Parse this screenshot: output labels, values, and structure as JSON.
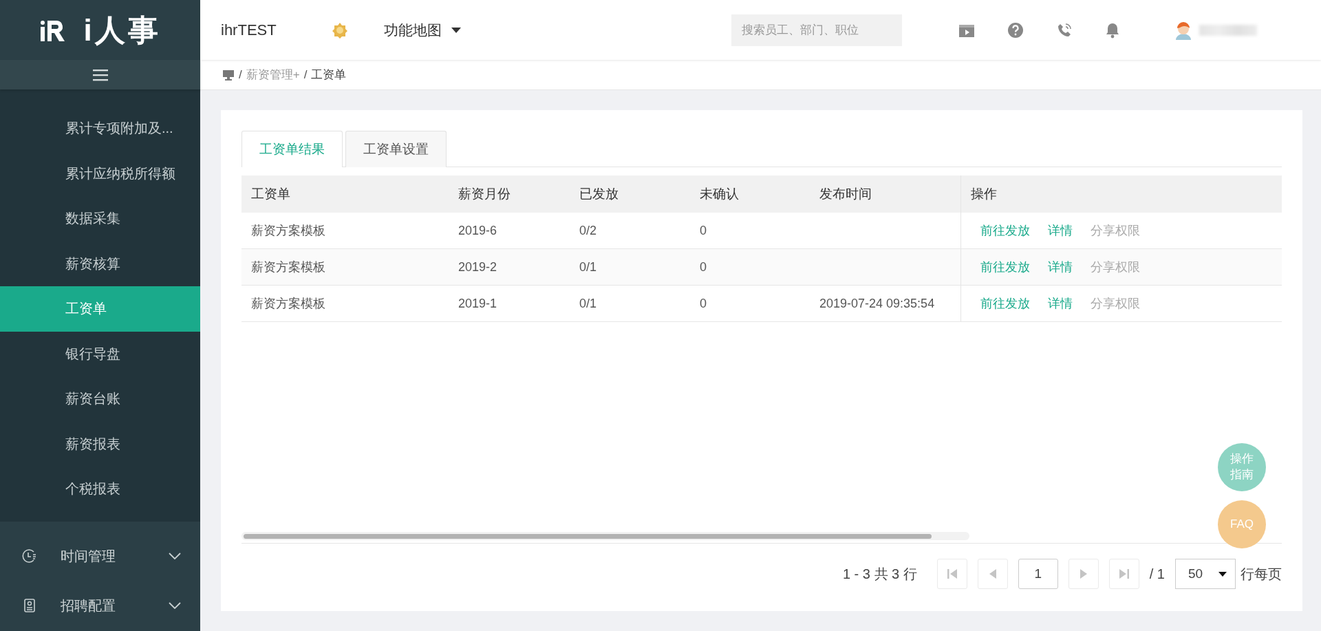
{
  "logo": {
    "text": "i人事"
  },
  "sidebar": {
    "items": [
      {
        "label": "累计专项附加及...",
        "selected": false
      },
      {
        "label": "累计应纳税所得额",
        "selected": false
      },
      {
        "label": "数据采集",
        "selected": false
      },
      {
        "label": "薪资核算",
        "selected": false
      },
      {
        "label": "工资单",
        "selected": true
      },
      {
        "label": "银行导盘",
        "selected": false
      },
      {
        "label": "薪资台账",
        "selected": false
      },
      {
        "label": "薪资报表",
        "selected": false
      },
      {
        "label": "个税报表",
        "selected": false
      }
    ],
    "sections": [
      {
        "label": "时间管理",
        "kind": "clock",
        "expanded": false
      },
      {
        "label": "招聘配置",
        "kind": "badge",
        "expanded": false
      }
    ]
  },
  "header": {
    "company": "ihrTEST",
    "menu": "功能地图",
    "search": {
      "placeholder": "搜索员工、部门、职位"
    }
  },
  "breadcrumb": {
    "separator": "/",
    "items": [
      {
        "label": "薪资管理+",
        "kind": "link"
      },
      {
        "label": "工资单",
        "kind": "current"
      }
    ]
  },
  "tabs": [
    {
      "label": "工资单结果",
      "selected": true
    },
    {
      "label": "工资单设置",
      "selected": false
    }
  ],
  "table": {
    "columns": [
      "工资单",
      "薪资月份",
      "已发放",
      "未确认",
      "发布时间",
      "操作"
    ],
    "rows": [
      {
        "cells": [
          "薪资方案模板",
          "2019-6",
          "0/2",
          "0",
          ""
        ],
        "actions": [
          {
            "label": "前往发放",
            "disabled": false
          },
          {
            "label": "详情",
            "disabled": false
          },
          {
            "label": "分享权限",
            "disabled": true
          }
        ]
      },
      {
        "cells": [
          "薪资方案模板",
          "2019-2",
          "0/1",
          "0",
          ""
        ],
        "actions": [
          {
            "label": "前往发放",
            "disabled": false
          },
          {
            "label": "详情",
            "disabled": false
          },
          {
            "label": "分享权限",
            "disabled": true
          }
        ]
      },
      {
        "cells": [
          "薪资方案模板",
          "2019-1",
          "0/1",
          "0",
          "2019-07-24 09:35:54"
        ],
        "actions": [
          {
            "label": "前往发放",
            "disabled": false
          },
          {
            "label": "详情",
            "disabled": false
          },
          {
            "label": "分享权限",
            "disabled": true
          }
        ]
      }
    ]
  },
  "pagination": {
    "summary": "1 - 3 共 3 行",
    "page": "1",
    "total": "/ 1",
    "page_size": "50",
    "per_page_label": "行每页",
    "nav": [
      {
        "kind": "first",
        "disabled": true
      },
      {
        "kind": "prev",
        "disabled": true
      },
      {
        "kind": "next",
        "disabled": true
      },
      {
        "kind": "last",
        "disabled": true
      }
    ]
  },
  "float_buttons": [
    {
      "label": "操作指南",
      "kind": "guide"
    },
    {
      "label": "FAQ",
      "kind": "faq"
    }
  ]
}
